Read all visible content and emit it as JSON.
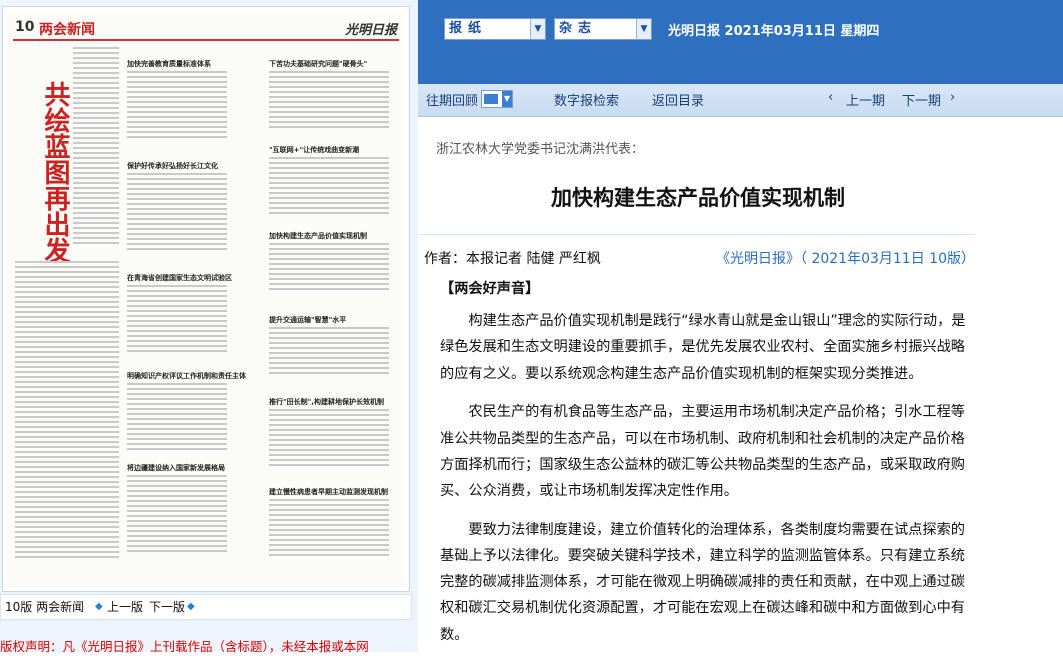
{
  "newspaper": {
    "page_label": "10",
    "section": "两会新闻",
    "logo": "光明日报",
    "big_title": "共绘蓝图再出发",
    "article_titles": [
      "加快完善教育质量标准体系",
      "保护好传承好弘扬好长江文化",
      "在青海省创建国家生态文明试验区",
      "明确知识产权评议工作机制和责任主体",
      "将边疆建设纳入国家新发展格局",
      "下苦功夫基础研究问题\"硬骨头\"",
      "\"互联网+\"让传统戏曲变新潮",
      "加快构建生态产品价值实现机制",
      "提升交通运输\"智慧\"水平",
      "推行\"田长制\",构建耕地保护长效机制",
      "建立慢性病患者早期主动监测发现机制"
    ]
  },
  "page_nav": {
    "current_page": "10版 两会新闻",
    "prev_label": "上一版",
    "next_label": "下一版"
  },
  "copyright": "版权声明：凡《光明日报》上刊载作品（含标题），未经本报或本网",
  "toolbar": {
    "paper_select": "报纸",
    "magazine_select": "杂志",
    "date_line": "光明日报  2021年03月11日  星期四"
  },
  "nav": {
    "back_issues": "往期回顾",
    "search": "数字报检索",
    "return_toc": "返回目录",
    "prev_period": "上一期",
    "next_period": "下一期"
  },
  "article": {
    "subtitle": "浙江农林大学党委书记沈满洪代表：",
    "title": "加快构建生态产品价值实现机制",
    "author": "作者：本报记者 陆健 严红枫",
    "source": "《光明日报》（ 2021年03月11日   10版）",
    "tag": "【两会好声音】",
    "paragraphs": [
      "构建生态产品价值实现机制是践行“绿水青山就是金山银山”理念的实际行动，是绿色发展和生态文明建设的重要抓手，是优先发展农业农村、全面实施乡村振兴战略的应有之义。要以系统观念构建生态产品价值实现机制的框架实现分类推进。",
      "农民生产的有机食品等生态产品，主要运用市场机制决定产品价格；引水工程等准公共物品类型的生态产品，可以在市场机制、政府机制和社会机制的决定产品价格方面择机而行；国家级生态公益林的碳汇等公共物品类型的生态产品，或采取政府购买、公众消费，或让市场机制发挥决定性作用。",
      "要致力法律制度建设，建立价值转化的治理体系，各类制度均需要在试点探索的基础上予以法律化。要突破关键科学技术，建立科学的监测监管体系。只有建立系统完整的碳减排监测体系，才可能在微观上明确碳减排的责任和贡献，在中观上通过碳权和碳汇交易机制优化资源配置，才可能在宏观上在碳达峰和碳中和方面做到心中有数。"
    ]
  }
}
